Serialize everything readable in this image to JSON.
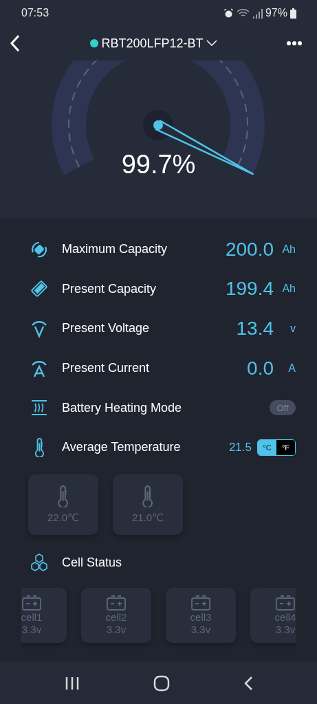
{
  "status_bar": {
    "time": "07:53",
    "battery": "97%"
  },
  "header": {
    "title": "RBT200LFP12-BT",
    "connected": true
  },
  "gauge": {
    "reading": "99.7%"
  },
  "metrics": [
    {
      "kind": "reading",
      "label": "Maximum Capacity",
      "value": "200.0",
      "unit": "Ah"
    },
    {
      "kind": "reading",
      "label": "Present Capacity",
      "value": "199.4",
      "unit": "Ah"
    },
    {
      "kind": "reading",
      "label": "Present Voltage",
      "value": "13.4",
      "unit": "v"
    },
    {
      "kind": "reading",
      "label": "Present Current",
      "value": "0.0",
      "unit": "A"
    },
    {
      "kind": "switch",
      "label": "Battery Heating Mode",
      "on": false,
      "state_label": "Off"
    },
    {
      "kind": "temperature",
      "label": "Average Temperature",
      "value": "21.5",
      "units": [
        {
          "label": "°C",
          "selected": true
        },
        {
          "label": "°F",
          "selected": false
        }
      ]
    }
  ],
  "sensors": [
    {
      "reading": "22.0℃"
    },
    {
      "reading": "21.0℃"
    }
  ],
  "cell_status": {
    "title": "Cell Status",
    "cells": [
      {
        "name": "cell1",
        "voltage": "3.3v"
      },
      {
        "name": "cell2",
        "voltage": "3.3v"
      },
      {
        "name": "cell3",
        "voltage": "3.3v"
      },
      {
        "name": "cell4",
        "voltage": "3.3v"
      }
    ]
  }
}
